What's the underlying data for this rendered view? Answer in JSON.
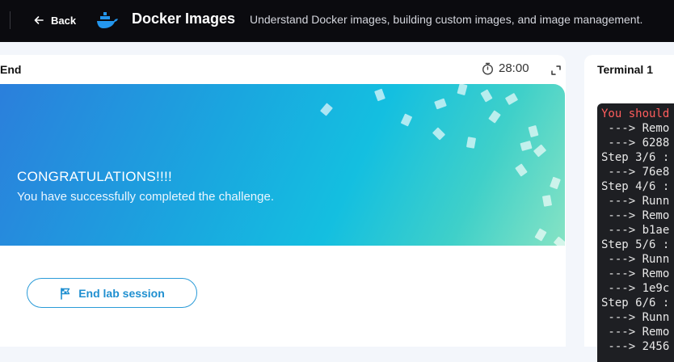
{
  "header": {
    "back_label": "Back",
    "title": "Docker Images",
    "subtitle": "Understand Docker images, building custom images, and image management."
  },
  "left_panel": {
    "tab_label": "End",
    "timer": "28:00",
    "banner": {
      "title": "CONGRATULATIONS!!!!",
      "message": "You have successfully completed the challenge."
    },
    "end_button_label": "End lab session"
  },
  "right_panel": {
    "tab_label": "Terminal 1",
    "terminal_lines": [
      "You should",
      " ---> Remo",
      " ---> 6288",
      "Step 3/6 :",
      " ---> 76e8",
      "Step 4/6 :",
      " ---> Runn",
      " ---> Remo",
      " ---> b1ae",
      "Step 5/6 :",
      " ---> Runn",
      " ---> Remo",
      " ---> 1e9c",
      "Step 6/6 :",
      " ---> Runn",
      " ---> Remo",
      " ---> 2456"
    ]
  },
  "colors": {
    "topbar": "#0b0b0f",
    "accent": "#1f8fd0",
    "docker_blue": "#2496ed",
    "terminal_bg": "#1e1f23",
    "terminal_error": "#ff5d5d"
  },
  "icons": {
    "back": "arrow-left-icon",
    "logo": "docker-whale-icon",
    "timer": "stopwatch-icon",
    "expand": "expand-icon",
    "end_button": "flag-icon"
  }
}
